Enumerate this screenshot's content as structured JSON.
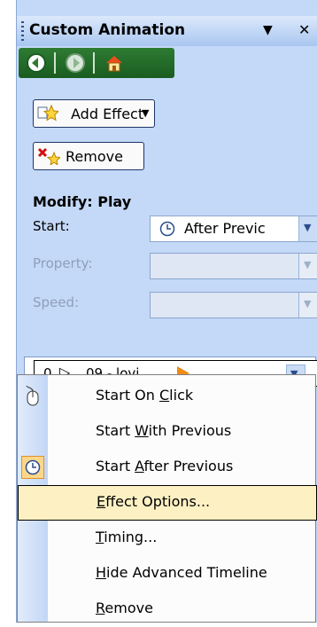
{
  "taskpane": {
    "title": "Custom Animation",
    "close_glyph": "✕"
  },
  "toolbar": {
    "add_effect_label": "Add Effect",
    "remove_label": "Remove"
  },
  "modify": {
    "heading": "Modify: Play",
    "start_label": "Start:",
    "start_value": "After Previc",
    "property_label": "Property:",
    "speed_label": "Speed:"
  },
  "effect_list": {
    "item": {
      "order": "0",
      "name": "09 - lovi..."
    }
  },
  "context_menu": {
    "items": [
      {
        "pre": "Start On ",
        "key": "C",
        "post": "lick"
      },
      {
        "pre": "Start ",
        "key": "W",
        "post": "ith Previous"
      },
      {
        "pre": "Start ",
        "key": "A",
        "post": "fter Previous"
      },
      {
        "pre": "",
        "key": "E",
        "post": "ffect Options..."
      },
      {
        "pre": "",
        "key": "T",
        "post": "iming..."
      },
      {
        "pre": "",
        "key": "H",
        "post": "ide Advanced Timeline"
      },
      {
        "pre": "",
        "key": "R",
        "post": "emove"
      }
    ]
  },
  "colors": {
    "panel": "#c4d9f7",
    "highlight": "#fdf1c4",
    "nav_green": "#2e7b33",
    "orange_marker": "#f08a12"
  }
}
